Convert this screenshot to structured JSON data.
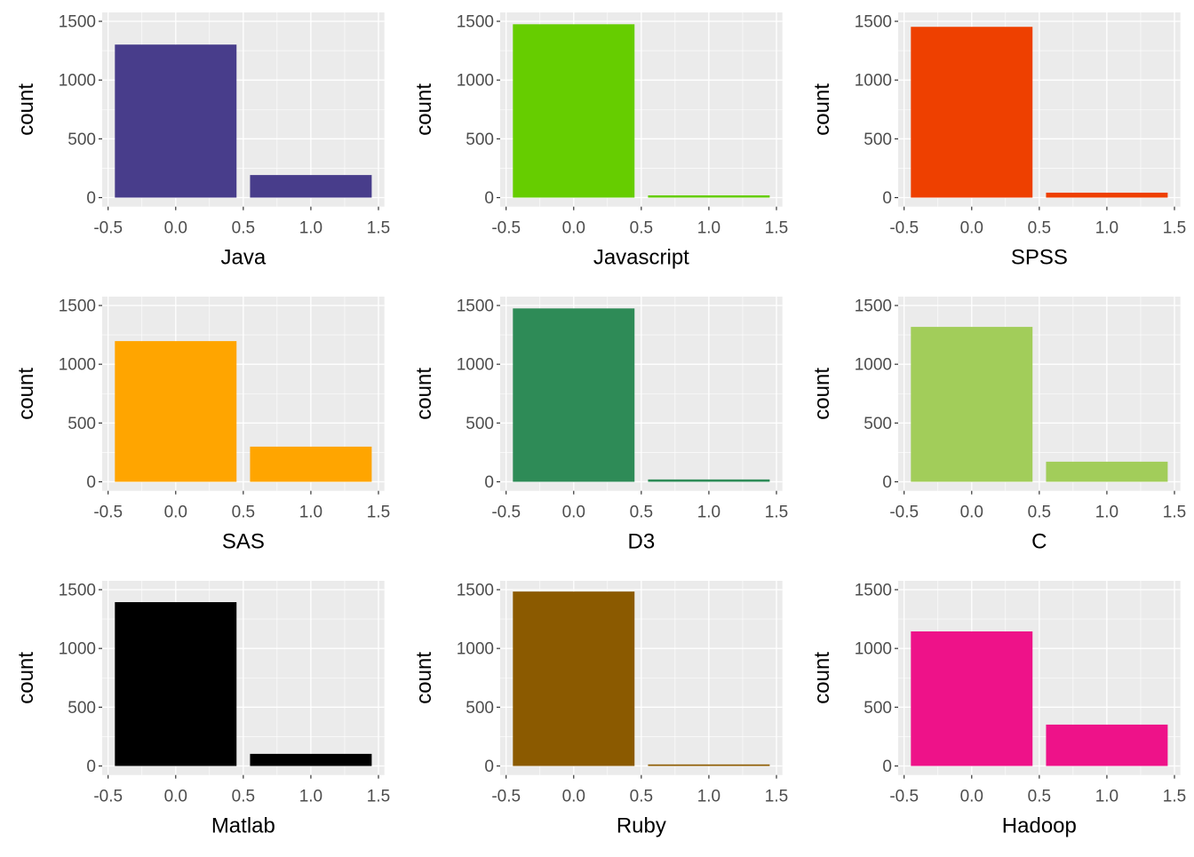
{
  "chart_data": [
    {
      "type": "bar",
      "title": "",
      "xlabel": "Java",
      "ylabel": "count",
      "color": "#483D8B",
      "x": [
        0,
        1
      ],
      "values": [
        1302,
        192
      ],
      "xlim": [
        -0.5,
        1.5
      ],
      "ylim": [
        0,
        1500
      ],
      "xticks": [
        "-0.5",
        "0.0",
        "0.5",
        "1.0",
        "1.5"
      ],
      "yticks": [
        "0",
        "500",
        "1000",
        "1500"
      ],
      "grid": true,
      "legend": "none"
    },
    {
      "type": "bar",
      "title": "",
      "xlabel": "Javascript",
      "ylabel": "count",
      "color": "#66CD00",
      "x": [
        0,
        1
      ],
      "values": [
        1475,
        19
      ],
      "xlim": [
        -0.5,
        1.5
      ],
      "ylim": [
        0,
        1500
      ],
      "xticks": [
        "-0.5",
        "0.0",
        "0.5",
        "1.0",
        "1.5"
      ],
      "yticks": [
        "0",
        "500",
        "1000",
        "1500"
      ],
      "grid": true,
      "legend": "none"
    },
    {
      "type": "bar",
      "title": "",
      "xlabel": "SPSS",
      "ylabel": "count",
      "color": "#EE4000",
      "x": [
        0,
        1
      ],
      "values": [
        1453,
        42
      ],
      "xlim": [
        -0.5,
        1.5
      ],
      "ylim": [
        0,
        1500
      ],
      "xticks": [
        "-0.5",
        "0.0",
        "0.5",
        "1.0",
        "1.5"
      ],
      "yticks": [
        "0",
        "500",
        "1000",
        "1500"
      ],
      "grid": true,
      "legend": "none"
    },
    {
      "type": "bar",
      "title": "",
      "xlabel": "SAS",
      "ylabel": "count",
      "color": "#FFA500",
      "x": [
        0,
        1
      ],
      "values": [
        1197,
        299
      ],
      "xlim": [
        -0.5,
        1.5
      ],
      "ylim": [
        0,
        1500
      ],
      "xticks": [
        "-0.5",
        "0.0",
        "0.5",
        "1.0",
        "1.5"
      ],
      "yticks": [
        "0",
        "500",
        "1000",
        "1500"
      ],
      "grid": true,
      "legend": "none"
    },
    {
      "type": "bar",
      "title": "",
      "xlabel": "D3",
      "ylabel": "count",
      "color": "#2E8B57",
      "x": [
        0,
        1
      ],
      "values": [
        1475,
        20
      ],
      "xlim": [
        -0.5,
        1.5
      ],
      "ylim": [
        0,
        1500
      ],
      "xticks": [
        "-0.5",
        "0.0",
        "0.5",
        "1.0",
        "1.5"
      ],
      "yticks": [
        "0",
        "500",
        "1000",
        "1500"
      ],
      "grid": true,
      "legend": "none"
    },
    {
      "type": "bar",
      "title": "",
      "xlabel": "C",
      "ylabel": "count",
      "color": "#A2CD5A",
      "x": [
        0,
        1
      ],
      "values": [
        1318,
        171
      ],
      "xlim": [
        -0.5,
        1.5
      ],
      "ylim": [
        0,
        1500
      ],
      "xticks": [
        "-0.5",
        "0.0",
        "0.5",
        "1.0",
        "1.5"
      ],
      "yticks": [
        "0",
        "500",
        "1000",
        "1500"
      ],
      "grid": true,
      "legend": "none"
    },
    {
      "type": "bar",
      "title": "",
      "xlabel": "Matlab",
      "ylabel": "count",
      "color": "#000000",
      "x": [
        0,
        1
      ],
      "values": [
        1394,
        103
      ],
      "xlim": [
        -0.5,
        1.5
      ],
      "ylim": [
        0,
        1500
      ],
      "xticks": [
        "-0.5",
        "0.0",
        "0.5",
        "1.0",
        "1.5"
      ],
      "yticks": [
        "0",
        "500",
        "1000",
        "1500"
      ],
      "grid": true,
      "legend": "none"
    },
    {
      "type": "bar",
      "title": "",
      "xlabel": "Ruby",
      "ylabel": "count",
      "color": "#8B5A00",
      "x": [
        0,
        1
      ],
      "values": [
        1484,
        13
      ],
      "xlim": [
        -0.5,
        1.5
      ],
      "ylim": [
        0,
        1500
      ],
      "xticks": [
        "-0.5",
        "0.0",
        "0.5",
        "1.0",
        "1.5"
      ],
      "yticks": [
        "0",
        "500",
        "1000",
        "1500"
      ],
      "grid": true,
      "legend": "none"
    },
    {
      "type": "bar",
      "title": "",
      "xlabel": "Hadoop",
      "ylabel": "count",
      "color": "#EE1289",
      "x": [
        0,
        1
      ],
      "values": [
        1145,
        352
      ],
      "xlim": [
        -0.5,
        1.5
      ],
      "ylim": [
        0,
        1500
      ],
      "xticks": [
        "-0.5",
        "0.0",
        "0.5",
        "1.0",
        "1.5"
      ],
      "yticks": [
        "0",
        "500",
        "1000",
        "1500"
      ],
      "grid": true,
      "legend": "none"
    }
  ]
}
